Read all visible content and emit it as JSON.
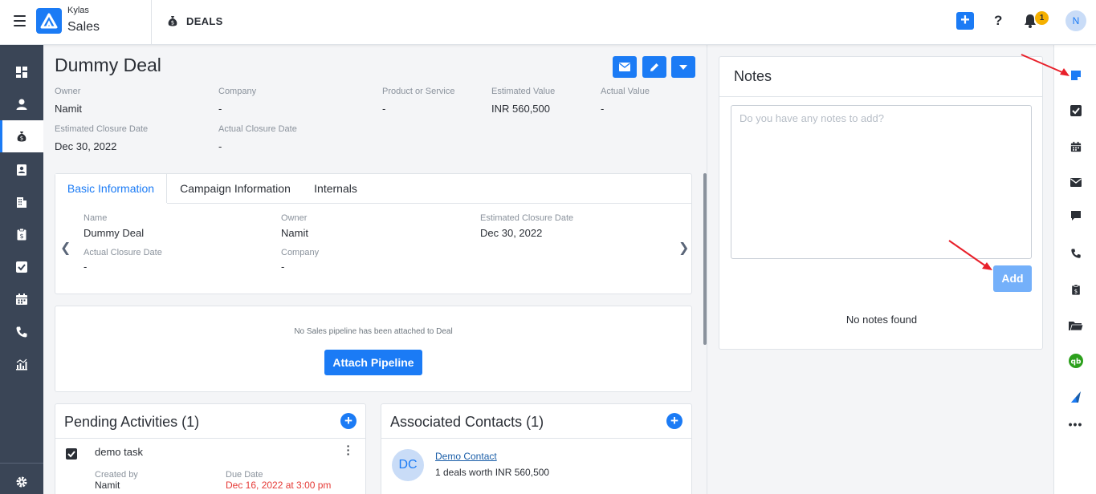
{
  "app": {
    "brand_top": "Kylas",
    "brand_bottom": "Sales",
    "module_title": "DEALS"
  },
  "topbar": {
    "help_label": "?",
    "notification_count": "1",
    "avatar_initial": "N",
    "add_label": "+"
  },
  "deal": {
    "title": "Dummy Deal",
    "fields_row1": [
      {
        "label": "Owner",
        "value": "Namit"
      },
      {
        "label": "Company",
        "value": "-"
      },
      {
        "label": "Product or Service",
        "value": "-"
      },
      {
        "label": "Estimated Value",
        "value": "INR 560,500"
      },
      {
        "label": "Actual Value",
        "value": "-"
      }
    ],
    "fields_row2": [
      {
        "label": "Estimated Closure Date",
        "value": "Dec 30, 2022"
      },
      {
        "label": "Actual Closure Date",
        "value": "-"
      }
    ]
  },
  "tabs": [
    {
      "label": "Basic Information"
    },
    {
      "label": "Campaign Information"
    },
    {
      "label": "Internals"
    }
  ],
  "basic_info": [
    {
      "label": "Name",
      "value": "Dummy Deal"
    },
    {
      "label": "Owner",
      "value": "Namit"
    },
    {
      "label": "Estimated Closure Date",
      "value": "Dec 30, 2022"
    },
    {
      "label": "Actual Closure Date",
      "value": "-"
    },
    {
      "label": "Company",
      "value": "-"
    }
  ],
  "pipeline": {
    "message": "No Sales pipeline has been attached to Deal",
    "button": "Attach Pipeline"
  },
  "pending_activities": {
    "title": "Pending Activities (1)",
    "task_name": "demo task",
    "created_by_label": "Created by",
    "created_by": "Namit",
    "due_date_label": "Due Date",
    "due_date": "Dec 16, 2022 at 3:00 pm"
  },
  "associated_contacts": {
    "title": "Associated Contacts (1)",
    "initials": "DC",
    "name": "Demo Contact",
    "deals": "1 deals worth INR 560,500"
  },
  "notes": {
    "title": "Notes",
    "placeholder": "Do you have any notes to add?",
    "add_button": "Add",
    "empty_message": "No notes found"
  },
  "rail_more": "•••",
  "colors": {
    "accent": "#1b7bf5",
    "nav_bg": "#3a4556",
    "due_red": "#e53935",
    "arrow_red": "#e8202a",
    "badge": "#f5b000"
  }
}
